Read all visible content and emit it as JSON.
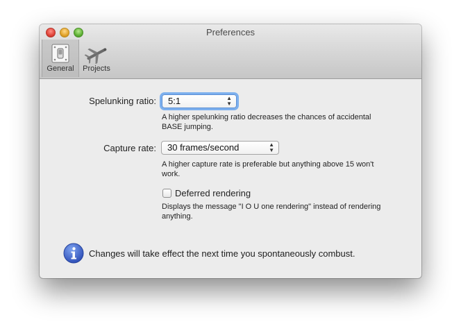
{
  "window": {
    "title": "Preferences"
  },
  "toolbar": {
    "general_label": "General",
    "projects_label": "Projects"
  },
  "settings": {
    "spelunking": {
      "label": "Spelunking ratio:",
      "value": "5:1",
      "help_line1": "A higher spelunking ratio decreases the chances of accidental",
      "help_line2": "BASE jumping."
    },
    "capture": {
      "label": "Capture rate:",
      "value": "30 frames/second",
      "help_line1": "A higher capture rate is preferable but anything above 15 won't",
      "help_line2": "work."
    },
    "deferred": {
      "label": "Deferred rendering",
      "checked": false,
      "help_line1": "Displays the message \"I O U one rendering\" instead of rendering",
      "help_line2": "anything."
    }
  },
  "notice": {
    "text": "Changes will take effect the next time you spontaneously combust."
  },
  "colors": {
    "accent": "#5c8fd4",
    "info": "#3f64c8",
    "window_bg": "#ececec"
  },
  "icons": [
    "close-icon",
    "minimize-icon",
    "zoom-icon",
    "switch-icon",
    "airplane-icon",
    "chevron-up-down-icon",
    "info-icon"
  ]
}
